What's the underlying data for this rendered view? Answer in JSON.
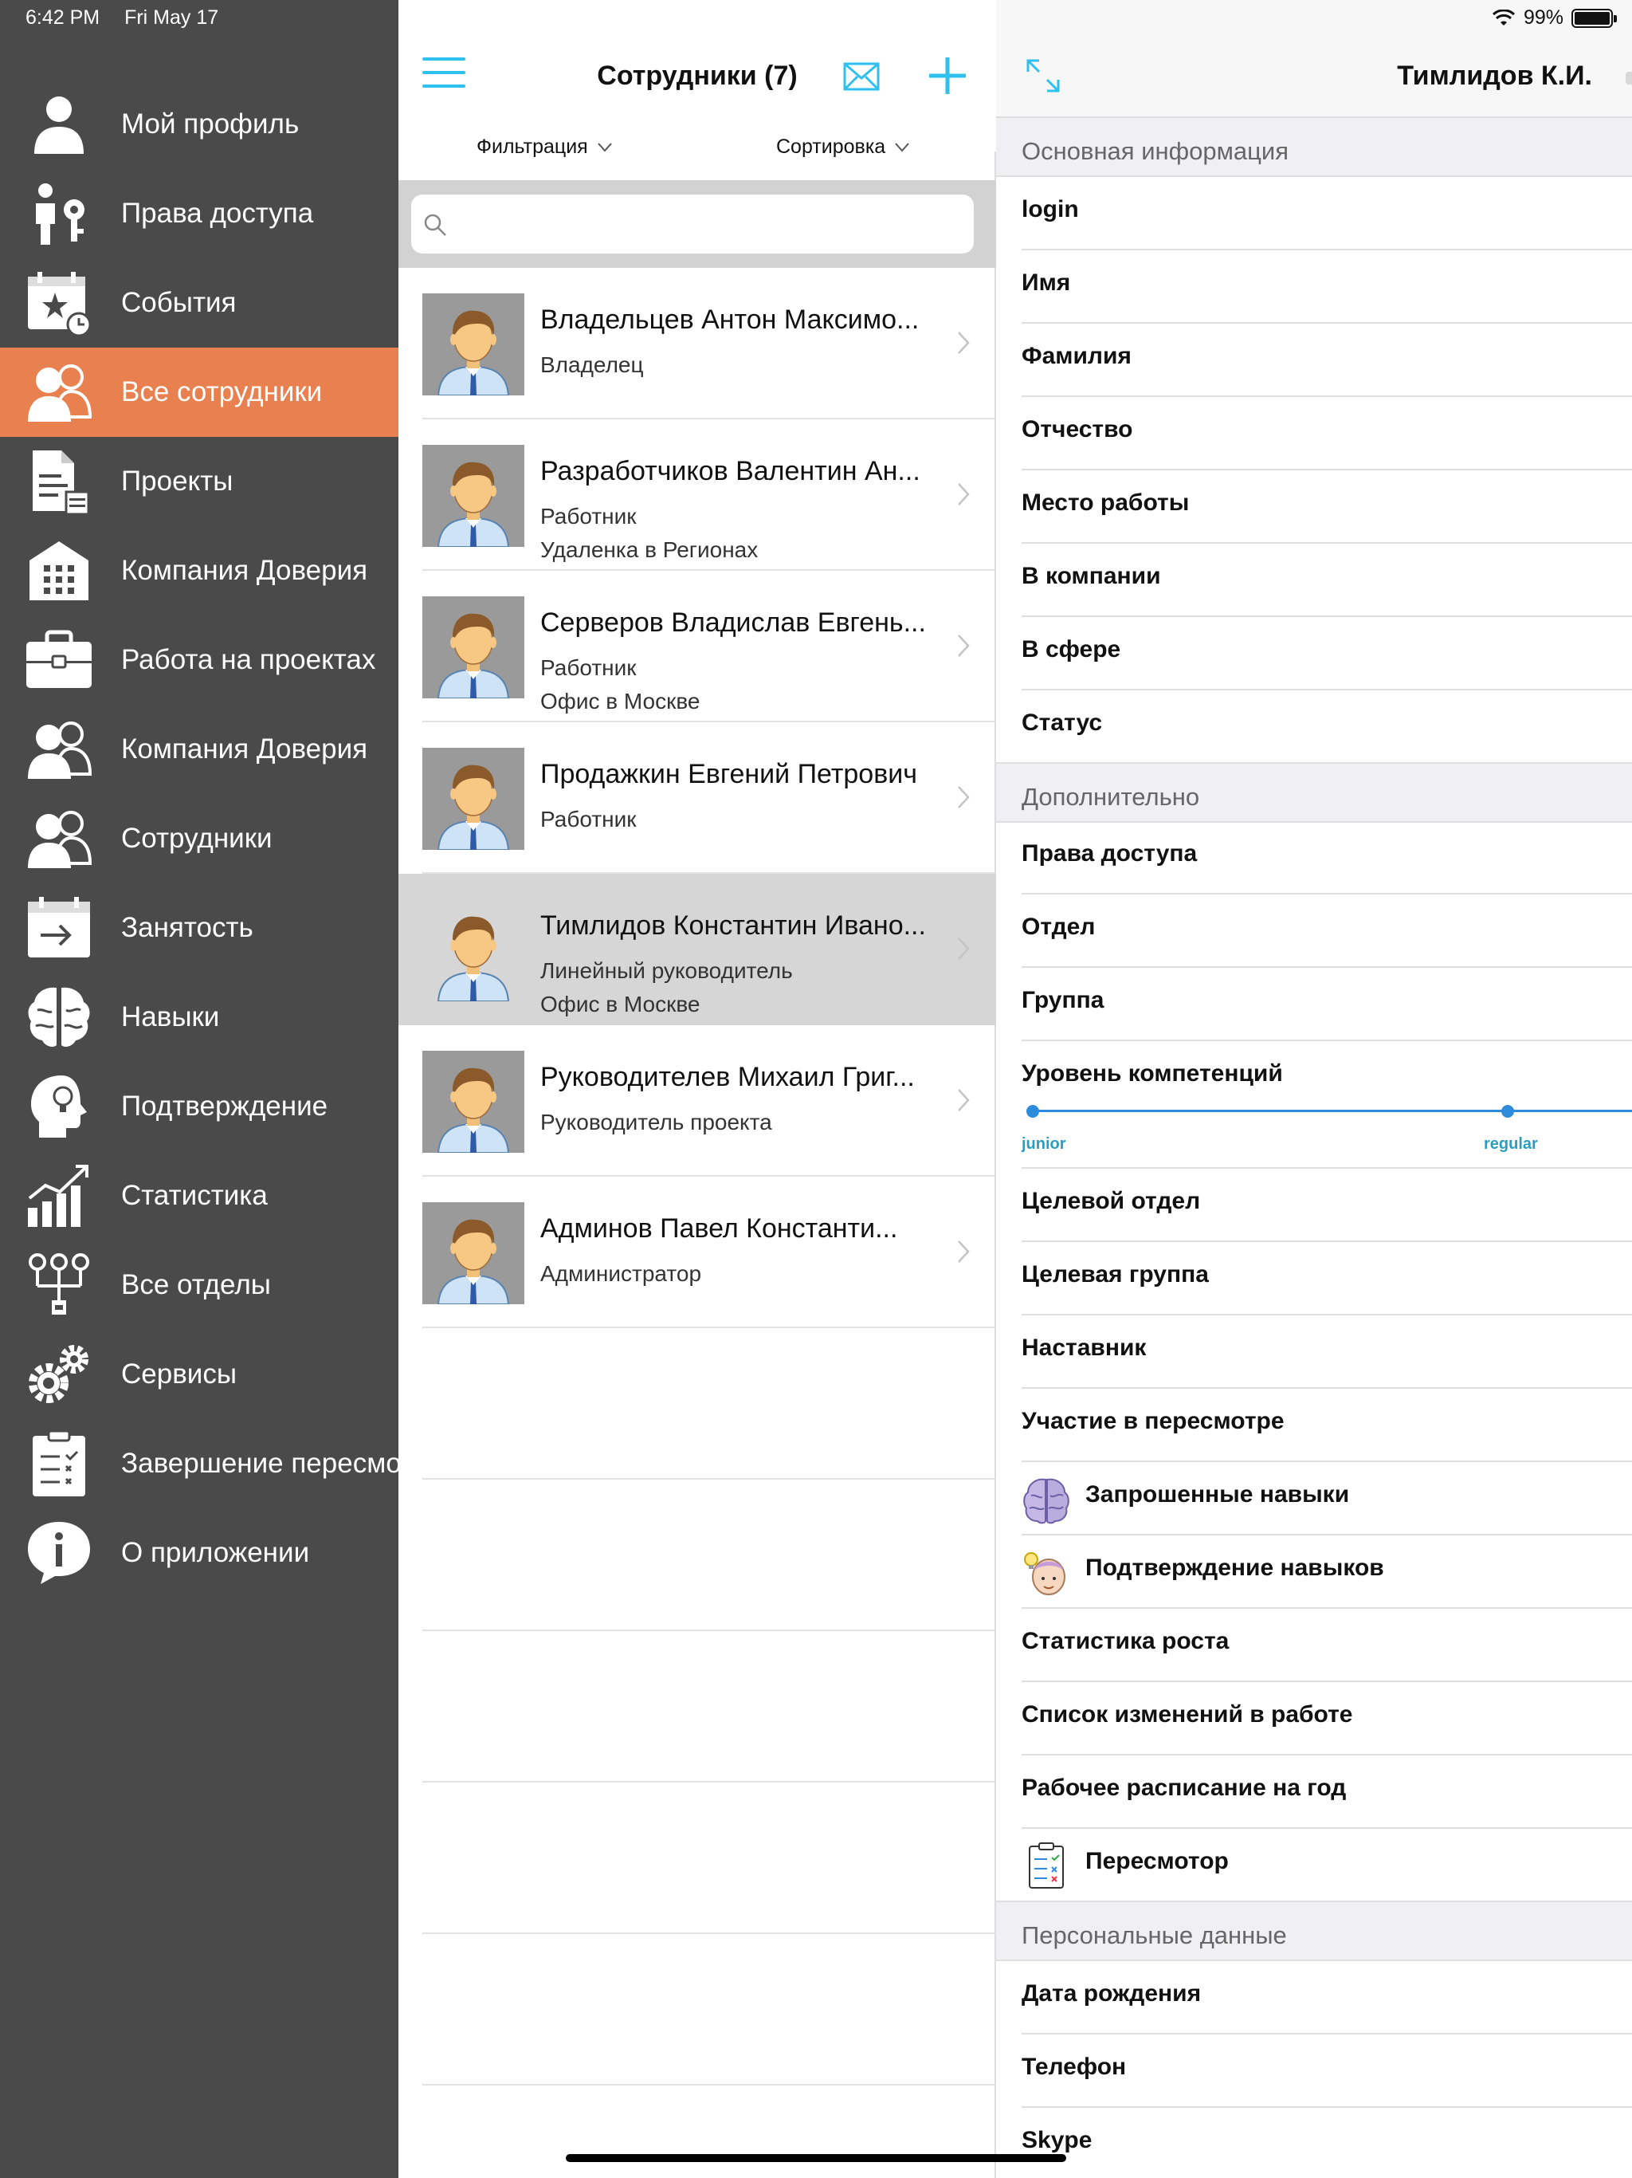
{
  "status_bar": {
    "time": "6:42 PM",
    "date": "Fri May 17",
    "battery": "99%"
  },
  "sidebar": {
    "items": [
      {
        "label": "Мой профиль",
        "icon": "user-icon"
      },
      {
        "label": "Права доступа",
        "icon": "access-key-icon"
      },
      {
        "label": "События",
        "icon": "calendar-star-icon"
      },
      {
        "label": "Все сотрудники",
        "icon": "users-icon",
        "active": true
      },
      {
        "label": "Проекты",
        "icon": "document-icon"
      },
      {
        "label": "Компания Доверия",
        "icon": "building-icon"
      },
      {
        "label": "Работа на проектах",
        "icon": "briefcase-icon"
      },
      {
        "label": "Компания Доверия",
        "icon": "users-icon"
      },
      {
        "label": "Сотрудники",
        "icon": "users-icon"
      },
      {
        "label": "Занятость",
        "icon": "calendar-arrow-icon"
      },
      {
        "label": "Навыки",
        "icon": "brain-icon"
      },
      {
        "label": "Подтверждение",
        "icon": "head-bulb-icon"
      },
      {
        "label": "Статистика",
        "icon": "chart-icon"
      },
      {
        "label": "Все отделы",
        "icon": "org-chart-icon"
      },
      {
        "label": "Сервисы",
        "icon": "gears-icon"
      },
      {
        "label": "Завершение пересмо",
        "icon": "checklist-icon"
      },
      {
        "label": "О приложении",
        "icon": "info-icon"
      }
    ]
  },
  "list": {
    "title": "Сотрудники (7)",
    "filter_label": "Фильтрация",
    "sort_label": "Сортировка",
    "search_placeholder": "",
    "employees": [
      {
        "name": "Владельцев Антон Максимо...",
        "role": "Владелец",
        "location": ""
      },
      {
        "name": "Разработчиков Валентин Ан...",
        "role": "Работник",
        "location": "Удаленка в Регионах"
      },
      {
        "name": "Серверов Владислав Евгень...",
        "role": "Работник",
        "location": "Офис в Москве"
      },
      {
        "name": "Продажкин Евгений Петрович",
        "role": "Работник",
        "location": ""
      },
      {
        "name": "Тимлидов Константин Ивано...",
        "role": "Линейный руководитель",
        "location": "Офис в Москве",
        "selected": true
      },
      {
        "name": "Руководителев Михаил Григ...",
        "role": "Руководитель проекта",
        "location": ""
      },
      {
        "name": "Админов Павел Константи...",
        "role": "Администратор",
        "location": ""
      }
    ]
  },
  "detail": {
    "title": "Тимлидов К.И.",
    "sections": {
      "basic": "Основная информация",
      "extra": "Дополнительно",
      "personal": "Персональные данные"
    },
    "basic_fields": [
      "login",
      "Имя",
      "Фамилия",
      "Отчество",
      "Место работы",
      "В компании",
      "В сфере",
      "Статус"
    ],
    "extra_fields_top": [
      "Права доступа",
      "Отдел",
      "Группа"
    ],
    "competence": {
      "label": "Уровень компетенций",
      "level_start": "junior",
      "level_end": "regular"
    },
    "extra_fields_bottom": [
      {
        "label": "Целевой отдел"
      },
      {
        "label": "Целевая группа"
      },
      {
        "label": "Наставник"
      },
      {
        "label": "Участие в пересмотре"
      },
      {
        "label": "Запрошенные навыки",
        "icon": "brain-icon"
      },
      {
        "label": "Подтверждение навыков",
        "icon": "face-bulb-icon"
      },
      {
        "label": "Статистика роста"
      },
      {
        "label": "Список изменений в работе"
      },
      {
        "label": "Рабочее расписание на год"
      },
      {
        "label": "Пересмотор",
        "icon": "checklist-icon"
      }
    ],
    "personal_fields": [
      "Дата рождения",
      "Телефон",
      "Skype"
    ]
  },
  "colors": {
    "sidebar": "#4a4a4a",
    "active": "#e8804f",
    "accent": "#2ec0ee",
    "slider": "#2e8bdc"
  }
}
